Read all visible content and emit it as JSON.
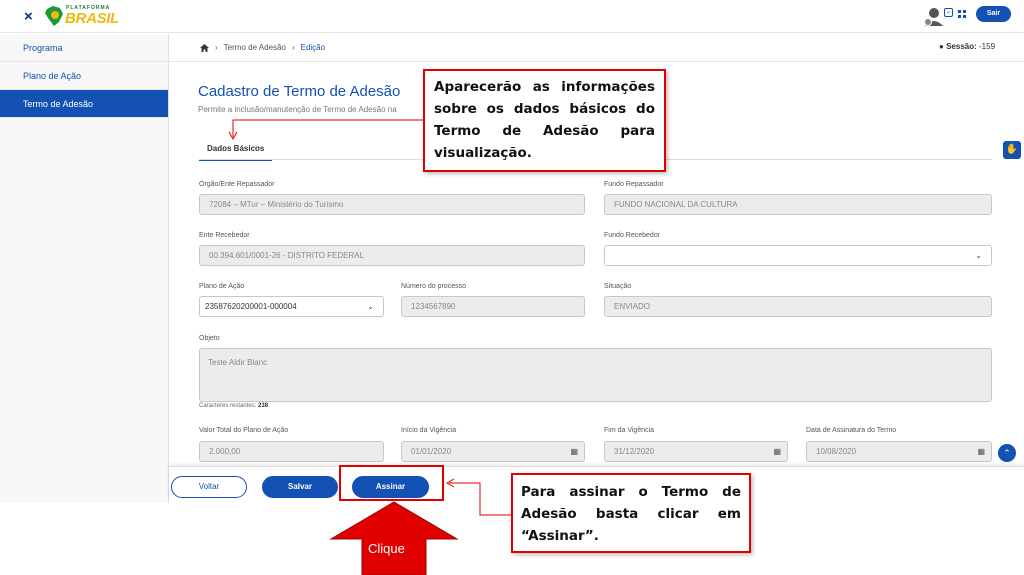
{
  "header": {
    "close_icon": "×",
    "logo_small": "PLATAFORMA",
    "logo_big": "BRASIL",
    "sair_label": "Sair"
  },
  "sidebar": {
    "items": [
      {
        "label": "Programa",
        "active": false
      },
      {
        "label": "Plano de Ação",
        "active": false
      },
      {
        "label": "Termo de Adesão",
        "active": true
      }
    ]
  },
  "breadcrumb": {
    "home_icon": "home-icon",
    "items": [
      "Termo de Adesão",
      "Edição"
    ]
  },
  "session": {
    "label": "Sessão:",
    "value": "-159"
  },
  "page": {
    "title": "Cadastro de Termo de Adesão",
    "subtitle": "Permite a inclusão/manutenção de Termo de Adesão na",
    "tab": "Dados Básicos"
  },
  "form": {
    "orgao": {
      "label": "Órgão/Ente Repassador",
      "value": "72084 – MTur – Ministério do Turismo"
    },
    "fundo_repassador": {
      "label": "Fundo Repassador",
      "value": "FUNDO NACIONAL DA CULTURA"
    },
    "ente_recebedor": {
      "label": "Ente Recebedor",
      "value": "00.394.601/0001-26 - DISTRITO FEDERAL"
    },
    "fundo_recebedor": {
      "label": "Fundo Recebedor",
      "value": ""
    },
    "plano_acao": {
      "label": "Plano de Ação",
      "value": "23587620200001-000004"
    },
    "numero_processo": {
      "label": "Número do processo",
      "value": "1234567890"
    },
    "situacao": {
      "label": "Situação",
      "value": "ENVIADO"
    },
    "objeto": {
      "label": "Objeto",
      "value": "Teste Aldir Blanc"
    },
    "chars_label": "Caracteres restantes:",
    "chars_value": "238",
    "valor_total": {
      "label": "Valor Total do Plano de Ação",
      "value": "2.000,00"
    },
    "inicio_vigencia": {
      "label": "Início da Vigência",
      "value": "01/01/2020"
    },
    "fim_vigencia": {
      "label": "Fim da Vigência",
      "value": "31/12/2020"
    },
    "data_assinatura": {
      "label": "Data de Assinatura do Termo",
      "value": "10/08/2020"
    }
  },
  "footer": {
    "voltar": "Voltar",
    "salvar": "Salvar",
    "assinar": "Assinar"
  },
  "annotations": {
    "top_callout": "Aparecerão as informações sobre os dados básicos do Termo de Adesão para visualização.",
    "bottom_callout": "Para assinar o Termo de Adesão basta clicar em “Assinar”.",
    "clique": "Clique",
    "color": "#e00000"
  },
  "colors": {
    "primary": "#1351b4"
  }
}
